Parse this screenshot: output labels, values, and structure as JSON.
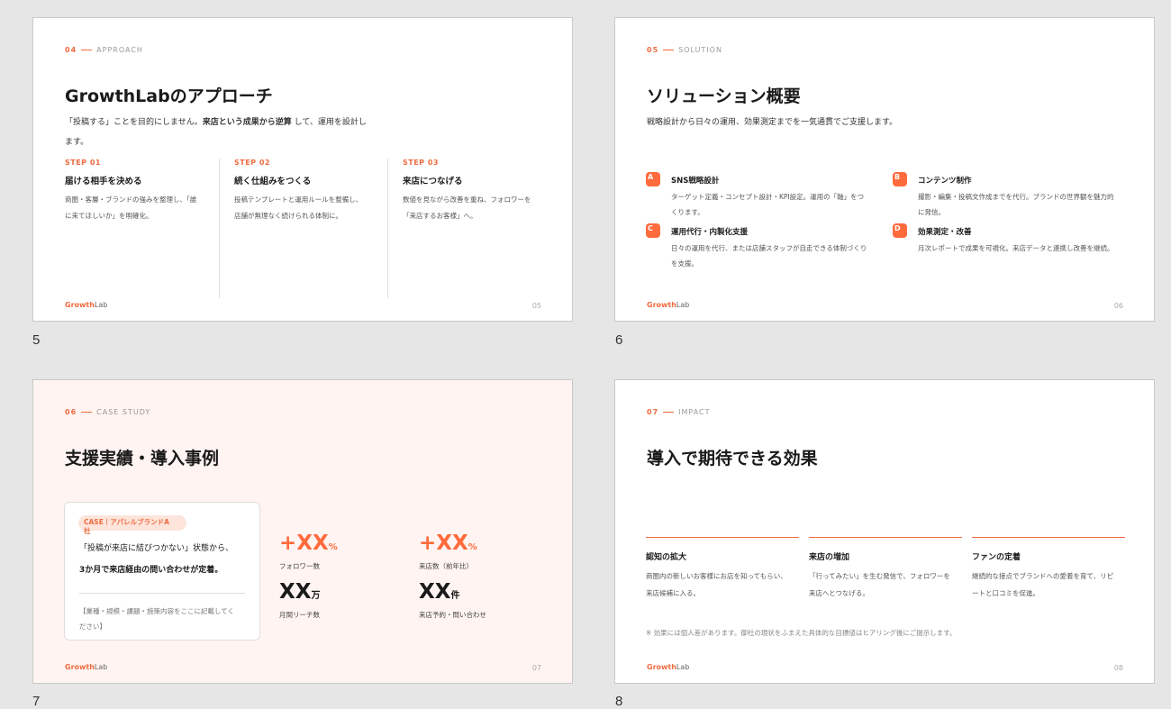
{
  "brand": {
    "growth": "Growth",
    "lab": "Lab"
  },
  "thumbnail_numbers": [
    "5",
    "6",
    "7",
    "8"
  ],
  "slide5": {
    "section_num": "04",
    "section_label": "APPROACH",
    "title": "GrowthLabのアプローチ",
    "sub_line1_a": "「投稿する」ことを目的にしません。",
    "sub_line1_b": "来店という成果から逆算",
    "sub_line1_c": " して、運用を設計し",
    "sub_line2": "ます。",
    "steps": [
      {
        "label": "STEP 01",
        "heading": "届ける相手を決める",
        "text1": "商圏・客層・ブランドの強みを整理し、「誰",
        "text2": "に来てほしいか」を明確化。"
      },
      {
        "label": "STEP 02",
        "heading": "続く仕組みをつくる",
        "text1": "投稿テンプレートと運用ルールを整備し、",
        "text2": "店舗が無理なく続けられる体制に。"
      },
      {
        "label": "STEP 03",
        "heading": "来店につなげる",
        "text1": "数値を見ながら改善を重ね、フォロワーを",
        "text2": "「来店するお客様」へ。"
      }
    ],
    "page": "05"
  },
  "slide6": {
    "section_num": "05",
    "section_label": "SOLUTION",
    "title": "ソリューション概要",
    "subtitle": "戦略設計から日々の運用、効果測定までを一気通貫でご支援します。",
    "items": [
      {
        "badge": "A",
        "heading": "SNS戦略設計",
        "text1": "ターゲット定義・コンセプト設計・KPI設定。運用の「軸」をつ",
        "text2": "くります。"
      },
      {
        "badge": "B",
        "heading": "コンテンツ制作",
        "text1": "撮影・編集・投稿文作成までを代行。ブランドの世界観を魅力的",
        "text2": "に発信。"
      },
      {
        "badge": "C",
        "heading": "運用代行・内製化支援",
        "text1": "日々の運用を代行、または店舗スタッフが自走できる体制づくり",
        "text2": "を支援。"
      },
      {
        "badge": "D",
        "heading": "効果測定・改善",
        "text1": "月次レポートで成果を可視化。来店データと連携し改善を継続。",
        "text2": ""
      }
    ],
    "page": "06"
  },
  "slide7": {
    "section_num": "06",
    "section_label": "CASE STUDY",
    "title": "支援実績・導入事例",
    "case_tag_line1": "CASE｜アパレルブランドA",
    "case_tag_line2": "社",
    "quote1": "「投稿が来店に結びつかない」状態から、",
    "quote2": "3か月で来店経由の問い合わせが定着。",
    "note1": "【業種・規模・課題・施策内容をここに記載してく",
    "note2": "ださい】",
    "kpis": [
      {
        "value": "+XX",
        "unit": "%",
        "label": "フォロワー数"
      },
      {
        "value": "+XX",
        "unit": "%",
        "label": "来店数（前年比）"
      },
      {
        "value": "XX",
        "unit": "万",
        "label": "月間リーチ数"
      },
      {
        "value": "XX",
        "unit": "件",
        "label": "来店予約・問い合わせ"
      }
    ],
    "page": "07"
  },
  "slide8": {
    "section_num": "07",
    "section_label": "IMPACT",
    "title": "導入で期待できる効果",
    "effects": [
      {
        "heading": "認知の拡大",
        "text1": "商圏内の新しいお客様にお店を知ってもらい、",
        "text2": "来店候補に入る。"
      },
      {
        "heading": "来店の増加",
        "text1": "「行ってみたい」を生む発信で、フォロワーを",
        "text2": "来店へとつなげる。"
      },
      {
        "heading": "ファンの定着",
        "text1": "継続的な接点でブランドへの愛着を育て、リピ",
        "text2": "ートと口コミを促進。"
      }
    ],
    "disclaimer": "※ 効果には個人差があります。御社の現状をふまえた具体的な目標値はヒアリング後にご提示します。",
    "page": "08"
  }
}
